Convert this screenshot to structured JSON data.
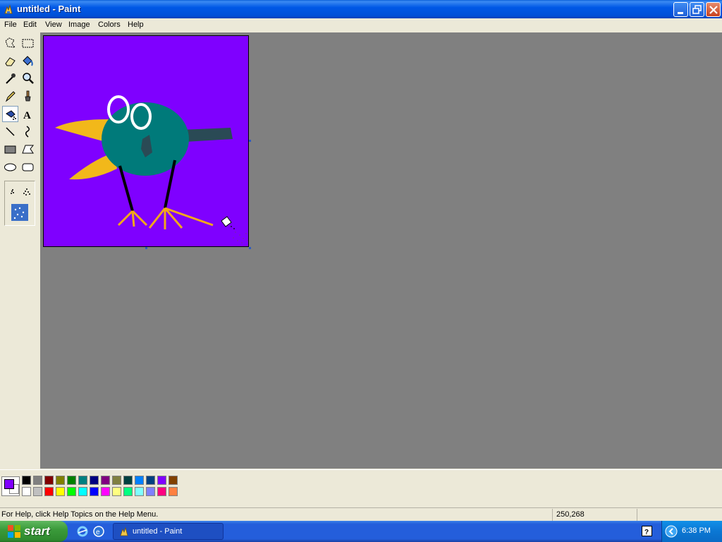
{
  "window": {
    "title": "untitled - Paint",
    "app_icon": "paint-icon"
  },
  "titlebar_buttons": {
    "minimize": "minimize-icon",
    "restore": "restore-icon",
    "close": "close-icon"
  },
  "menu": {
    "items": [
      "File",
      "Edit",
      "View",
      "Image",
      "Colors",
      "Help"
    ]
  },
  "tools": {
    "items": [
      "free-form-select",
      "select",
      "eraser",
      "fill-with-color",
      "pick-color",
      "magnifier",
      "pencil",
      "brush",
      "airbrush",
      "text",
      "line",
      "curve",
      "rectangle",
      "polygon",
      "ellipse",
      "rounded-rectangle"
    ],
    "selected": "airbrush"
  },
  "canvas": {
    "background_color": "#7f00ff",
    "drawing": "bird-picture"
  },
  "colors": {
    "foreground": "#8000ff",
    "background": "#ffffff",
    "palette_row1": [
      "#000000",
      "#808080",
      "#800000",
      "#808000",
      "#008000",
      "#008080",
      "#000080",
      "#800080",
      "#808040",
      "#004040",
      "#0080ff",
      "#004080",
      "#8000ff",
      "#804000"
    ],
    "palette_row2": [
      "#ffffff",
      "#c0c0c0",
      "#ff0000",
      "#ffff00",
      "#00ff00",
      "#00ffff",
      "#0000ff",
      "#ff00ff",
      "#ffff80",
      "#00ff80",
      "#80ffff",
      "#8080ff",
      "#ff0080",
      "#ff8040"
    ]
  },
  "status": {
    "help_text": "For Help, click Help Topics on the Help Menu.",
    "coordinates": "250,268"
  },
  "taskbar": {
    "start_label": "start",
    "task_label": "untitled - Paint",
    "clock": "6:38 PM"
  }
}
